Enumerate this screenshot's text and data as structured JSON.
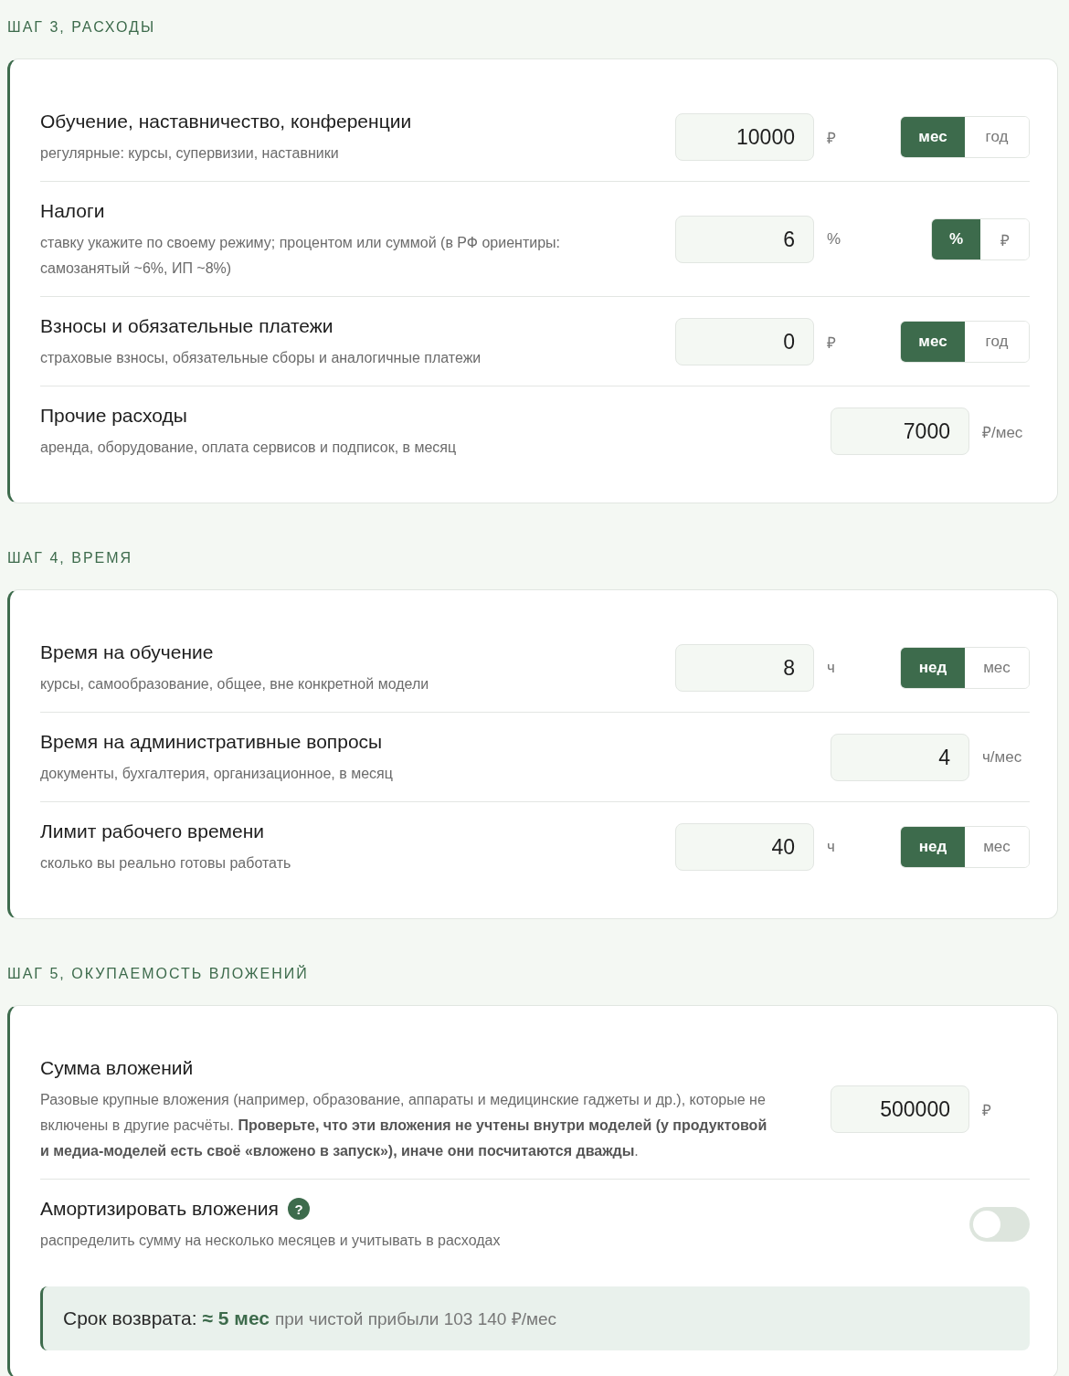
{
  "sections": [
    {
      "heading": "ШАГ 3, РАСХОДЫ",
      "rows": [
        {
          "kind": "input",
          "title": "Обучение, наставничество, конференции",
          "hint": "регулярные: курсы, супервизии, наставники",
          "value": "10000",
          "unit": "₽",
          "options": [
            {
              "label": "мес",
              "selected": true
            },
            {
              "label": "год",
              "selected": false
            }
          ]
        },
        {
          "kind": "input",
          "title": "Налоги",
          "hint": "ставку укажите по своему режиму; процентом или суммой (в РФ ориентиры: самозанятый ~6%, ИП ~8%)",
          "value": "6",
          "unit": "%",
          "options": [
            {
              "label": "%",
              "selected": true
            },
            {
              "label": "₽",
              "selected": false
            }
          ]
        },
        {
          "kind": "input",
          "title": "Взносы и обязательные платежи",
          "hint": "страховые взносы, обязательные сборы и аналогичные платежи",
          "value": "0",
          "unit": "₽",
          "options": [
            {
              "label": "мес",
              "selected": true
            },
            {
              "label": "год",
              "selected": false
            }
          ]
        },
        {
          "kind": "input",
          "title": "Прочие расходы",
          "hint": "аренда, оборудование, оплата сервисов и подписок, в месяц",
          "value": "7000",
          "unit": "₽/мес"
        }
      ]
    },
    {
      "heading": "ШАГ 4, ВРЕМЯ",
      "rows": [
        {
          "kind": "input",
          "title": "Время на обучение",
          "hint": "курсы, самообразование, общее, вне конкретной модели",
          "value": "8",
          "unit": "ч",
          "options": [
            {
              "label": "нед",
              "selected": true
            },
            {
              "label": "мес",
              "selected": false
            }
          ]
        },
        {
          "kind": "input",
          "title": "Время на административные вопросы",
          "hint": "документы, бухгалтерия, организационное, в месяц",
          "value": "4",
          "unit": "ч/мес"
        },
        {
          "kind": "input",
          "title": "Лимит рабочего времени",
          "hint": "сколько вы реально готовы работать",
          "value": "40",
          "unit": "ч",
          "options": [
            {
              "label": "нед",
              "selected": true
            },
            {
              "label": "мес",
              "selected": false
            }
          ]
        }
      ]
    },
    {
      "heading": "ШАГ 5, ОКУПАЕМОСТЬ ВЛОЖЕНИЙ",
      "rows": [
        {
          "kind": "input",
          "title": "Сумма вложений",
          "hint": "Разовые крупные вложения (например, образование, аппараты и медицинские гаджеты и др.), которые не включены в другие расчёты. **Проверьте, что эти вложения не учтены внутри моделей (у продуктовой и медиа-моделей есть своё «вложено в запуск»), иначе они посчитаются дважды**.",
          "value": "500000",
          "unit": "₽"
        },
        {
          "kind": "switch",
          "title": "Амортизировать вложения",
          "help": "?",
          "hint": "распределить сумму на несколько месяцев и учитывать в расходах",
          "on": false
        }
      ],
      "result": {
        "label": "Срок возврата:",
        "value": "≈ 5 мес",
        "note": "при чистой прибыли 103 140 ₽/мес"
      }
    }
  ]
}
